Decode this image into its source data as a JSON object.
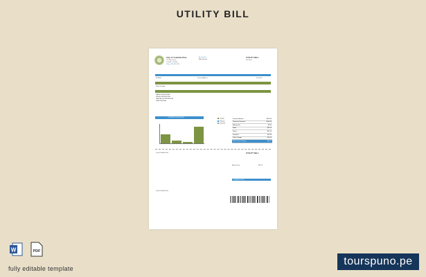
{
  "page": {
    "title": "UTILITY BILL",
    "footer_label": "fully editable template",
    "watermark": "tourspuno.pe",
    "icons": [
      "word-icon",
      "pdf-icon"
    ]
  },
  "bill": {
    "company_name": "City of Yorkville Pine",
    "total_label": "Total Amount Due",
    "summary_header": "CONSUMPTION HISTORY",
    "pay_label": "UTILITY BILL",
    "amount_due_label": "Amount Due",
    "amount_due_value": "$89.73",
    "current_charges": "$89.73",
    "service_rows": [
      "WATER RESIDENTIAL",
      "SEWER RESIDENTIAL",
      "SANITATION RESIDENTIAL",
      "LEAF REMOVAL"
    ],
    "totals_rows": [
      {
        "label": "Previous Balance",
        "value": "$124.80"
      },
      {
        "label": "Payments Received",
        "value": "-$124.80"
      },
      {
        "label": "Adjustments",
        "value": "$0.00"
      },
      {
        "label": "Water",
        "value": "$32.50"
      },
      {
        "label": "Sewer",
        "value": "$27.40"
      },
      {
        "label": "Sanitation",
        "value": "$19.83"
      },
      {
        "label": "Other Charges",
        "value": "$10.00"
      },
      {
        "label": "Total Current Charges",
        "value": "$89.73"
      }
    ],
    "legend": [
      "Current",
      "Previous",
      "Last Year"
    ]
  },
  "chart_data": {
    "type": "bar",
    "categories": [
      "1",
      "2",
      "3",
      "4"
    ],
    "values": [
      14,
      4,
      2,
      26
    ],
    "title": "CONSUMPTION HISTORY",
    "xlabel": "",
    "ylabel": "",
    "ylim": [
      0,
      30
    ]
  },
  "colors": {
    "accent_blue": "#3d8fcb",
    "accent_green": "#7d9442",
    "background": "#e9dfc9",
    "watermark_bg": "#16355a"
  }
}
